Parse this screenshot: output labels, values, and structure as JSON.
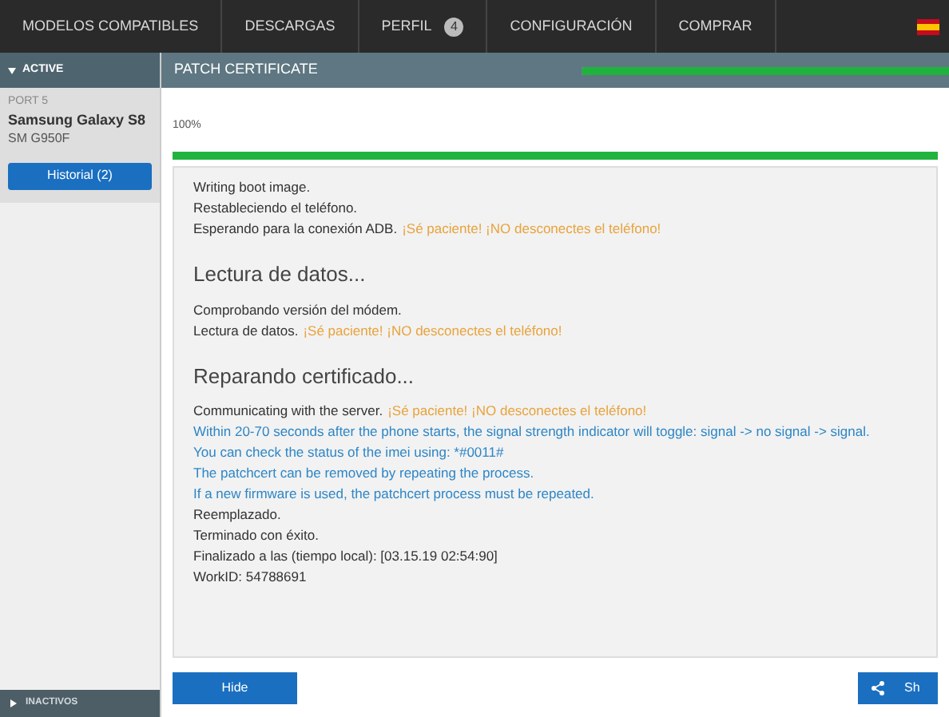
{
  "nav": [
    {
      "label": "MODELOS COMPATIBLES"
    },
    {
      "label": "DESCARGAS"
    },
    {
      "label": "PERFIL",
      "badge": "4"
    },
    {
      "label": "CONFIGURACIÓN"
    },
    {
      "label": "COMPRAR"
    }
  ],
  "sidebar": {
    "active_header": {
      "label": "ACTIVE",
      "expanded": true
    },
    "device": {
      "port": "PORT 5",
      "name": "Samsung Galaxy S8",
      "model": "SM G950F",
      "history_button": "Historial (2)"
    },
    "inactive_header": {
      "label": "INACTIVOS",
      "expanded": false
    }
  },
  "panel": {
    "title": "PATCH CERTIFICATE",
    "header_progress": {
      "level": 1
    },
    "progress_label": "100%",
    "progress": {
      "level": 1
    },
    "log": [
      {
        "kind": "text",
        "text": "Writing boot image."
      },
      {
        "kind": "text",
        "text": "Restableciendo el teléfono."
      },
      {
        "kind": "text",
        "text": "Esperando para la conexión ADB.",
        "note": "¡Sé paciente! ¡NO desconectes el teléfono!"
      },
      {
        "kind": "heading",
        "text": "Lectura de datos..."
      },
      {
        "kind": "text",
        "text": "Comprobando versión del módem."
      },
      {
        "kind": "text",
        "text": "Lectura de datos.",
        "note": "¡Sé paciente! ¡NO desconectes el teléfono!"
      },
      {
        "kind": "heading",
        "text": "Reparando certificado..."
      },
      {
        "kind": "text",
        "text": "Communicating with the server.",
        "note": "¡Sé paciente! ¡NO desconectes el teléfono!"
      },
      {
        "kind": "info",
        "text": "Within 20-70 seconds after the phone starts, the signal strength indicator will toggle: signal -> no signal -> signal."
      },
      {
        "kind": "info",
        "text": "You can check the status of the imei using: *#0011#"
      },
      {
        "kind": "info",
        "text": "The patchcert can be removed by repeating the process."
      },
      {
        "kind": "info",
        "text": "If a new firmware is used, the patchcert process must be repeated."
      },
      {
        "kind": "text",
        "text": "Reemplazado."
      },
      {
        "kind": "text",
        "text": "Terminado con éxito."
      },
      {
        "kind": "text",
        "text": "Finalizado a las (tiempo local): [03.15.19 02:54:90]"
      },
      {
        "kind": "text",
        "text": "WorkID: 54788691"
      }
    ],
    "hide_button": "Hide",
    "share_button": "Sh"
  }
}
